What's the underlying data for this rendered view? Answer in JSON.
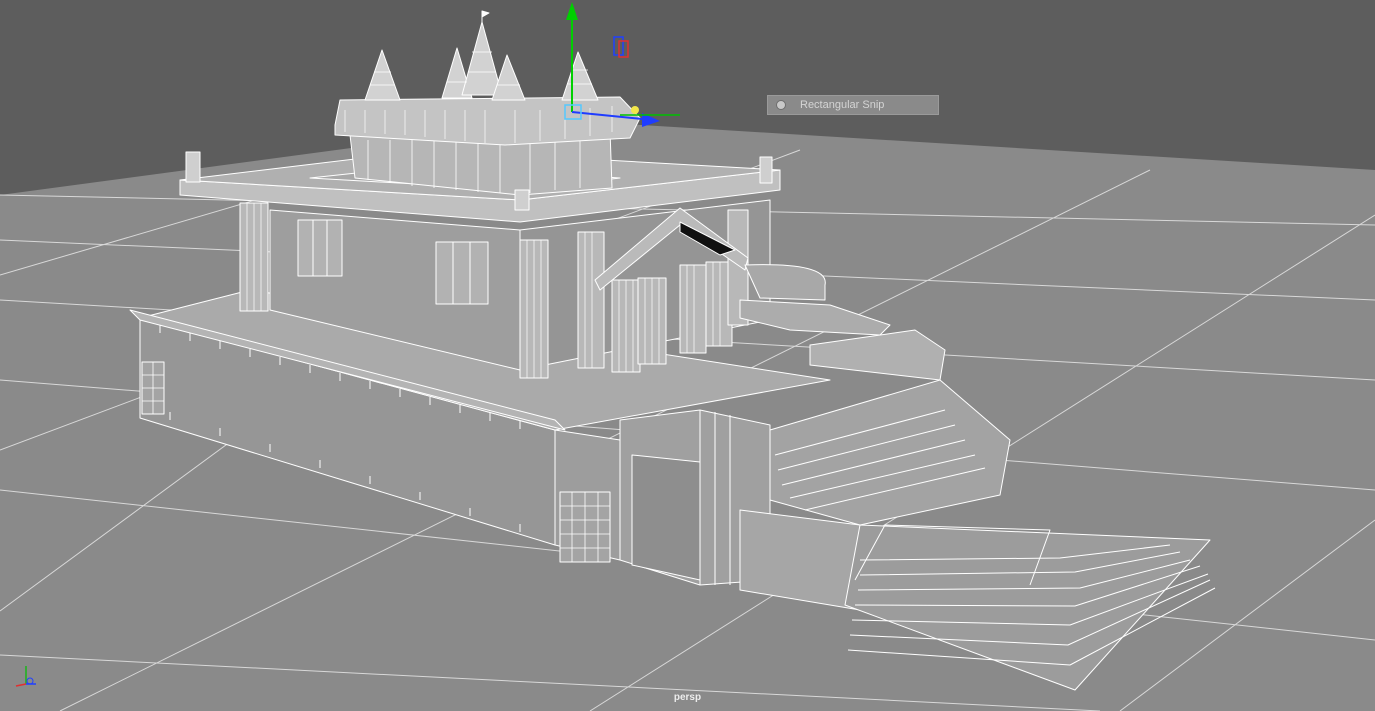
{
  "viewport": {
    "camera_label": "persp",
    "background_color": "#5d5d5d",
    "grid_color": "#8a8a8a",
    "wireframe_color": "#ffffff"
  },
  "tooltip": {
    "label": "Rectangular Snip",
    "icon": "snip-icon"
  },
  "manipulator": {
    "x_axis_color": "#1f3cff",
    "y_axis_color": "#00d000",
    "z_axis_color": "#00c000",
    "center_color": "#f2e64a"
  },
  "icons": {
    "axis_indicator": "axis-triad-icon",
    "camera_icon": "camera-icon"
  }
}
